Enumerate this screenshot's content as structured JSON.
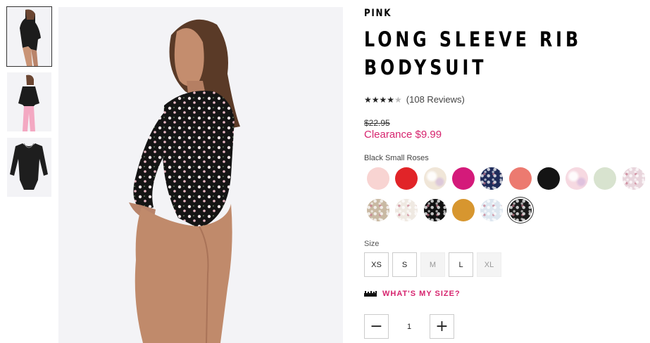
{
  "thumbnails": [
    {
      "label": "front view"
    },
    {
      "label": "outfit view"
    },
    {
      "label": "flat view"
    }
  ],
  "product": {
    "brand": "PINK",
    "title": "LONG SLEEVE RIB BODYSUIT",
    "rating": 4,
    "rating_max": 5,
    "reviews_text": "(108 Reviews)",
    "old_price": "$22.95",
    "sale_price": "Clearance $9.99"
  },
  "colors": {
    "selected_label": "Black Small Roses",
    "swatches": [
      {
        "name": "light-pink",
        "color": "#f8d4d2"
      },
      {
        "name": "red",
        "color": "#e12428"
      },
      {
        "name": "pastel-tie-dye",
        "color": "#f0e6d8"
      },
      {
        "name": "magenta",
        "color": "#d41a7a"
      },
      {
        "name": "navy-floral",
        "color": "#1f2c5a"
      },
      {
        "name": "coral",
        "color": "#ec7a70"
      },
      {
        "name": "black",
        "color": "#141414"
      },
      {
        "name": "pink-tie-dye",
        "color": "#f6d9e1"
      },
      {
        "name": "sage",
        "color": "#d8e3cf"
      },
      {
        "name": "mauve-print",
        "color": "#e8d5dc"
      },
      {
        "name": "leopard",
        "color": "#c9b9a3"
      },
      {
        "name": "cream-floral",
        "color": "#efe9e2"
      },
      {
        "name": "black-dot",
        "color": "#111111"
      },
      {
        "name": "mustard",
        "color": "#d7962f"
      },
      {
        "name": "light-blue-floral",
        "color": "#dde6ef"
      },
      {
        "name": "black-small-roses",
        "color": "#1b1b1b",
        "selected": true
      }
    ]
  },
  "size": {
    "label": "Size",
    "options": [
      {
        "label": "XS",
        "available": true
      },
      {
        "label": "S",
        "available": true
      },
      {
        "label": "M",
        "available": false
      },
      {
        "label": "L",
        "available": true
      },
      {
        "label": "XL",
        "available": false
      }
    ],
    "guide_label": "WHAT'S MY SIZE?"
  },
  "quantity": {
    "minus": "−",
    "value": "1",
    "plus": "+"
  }
}
